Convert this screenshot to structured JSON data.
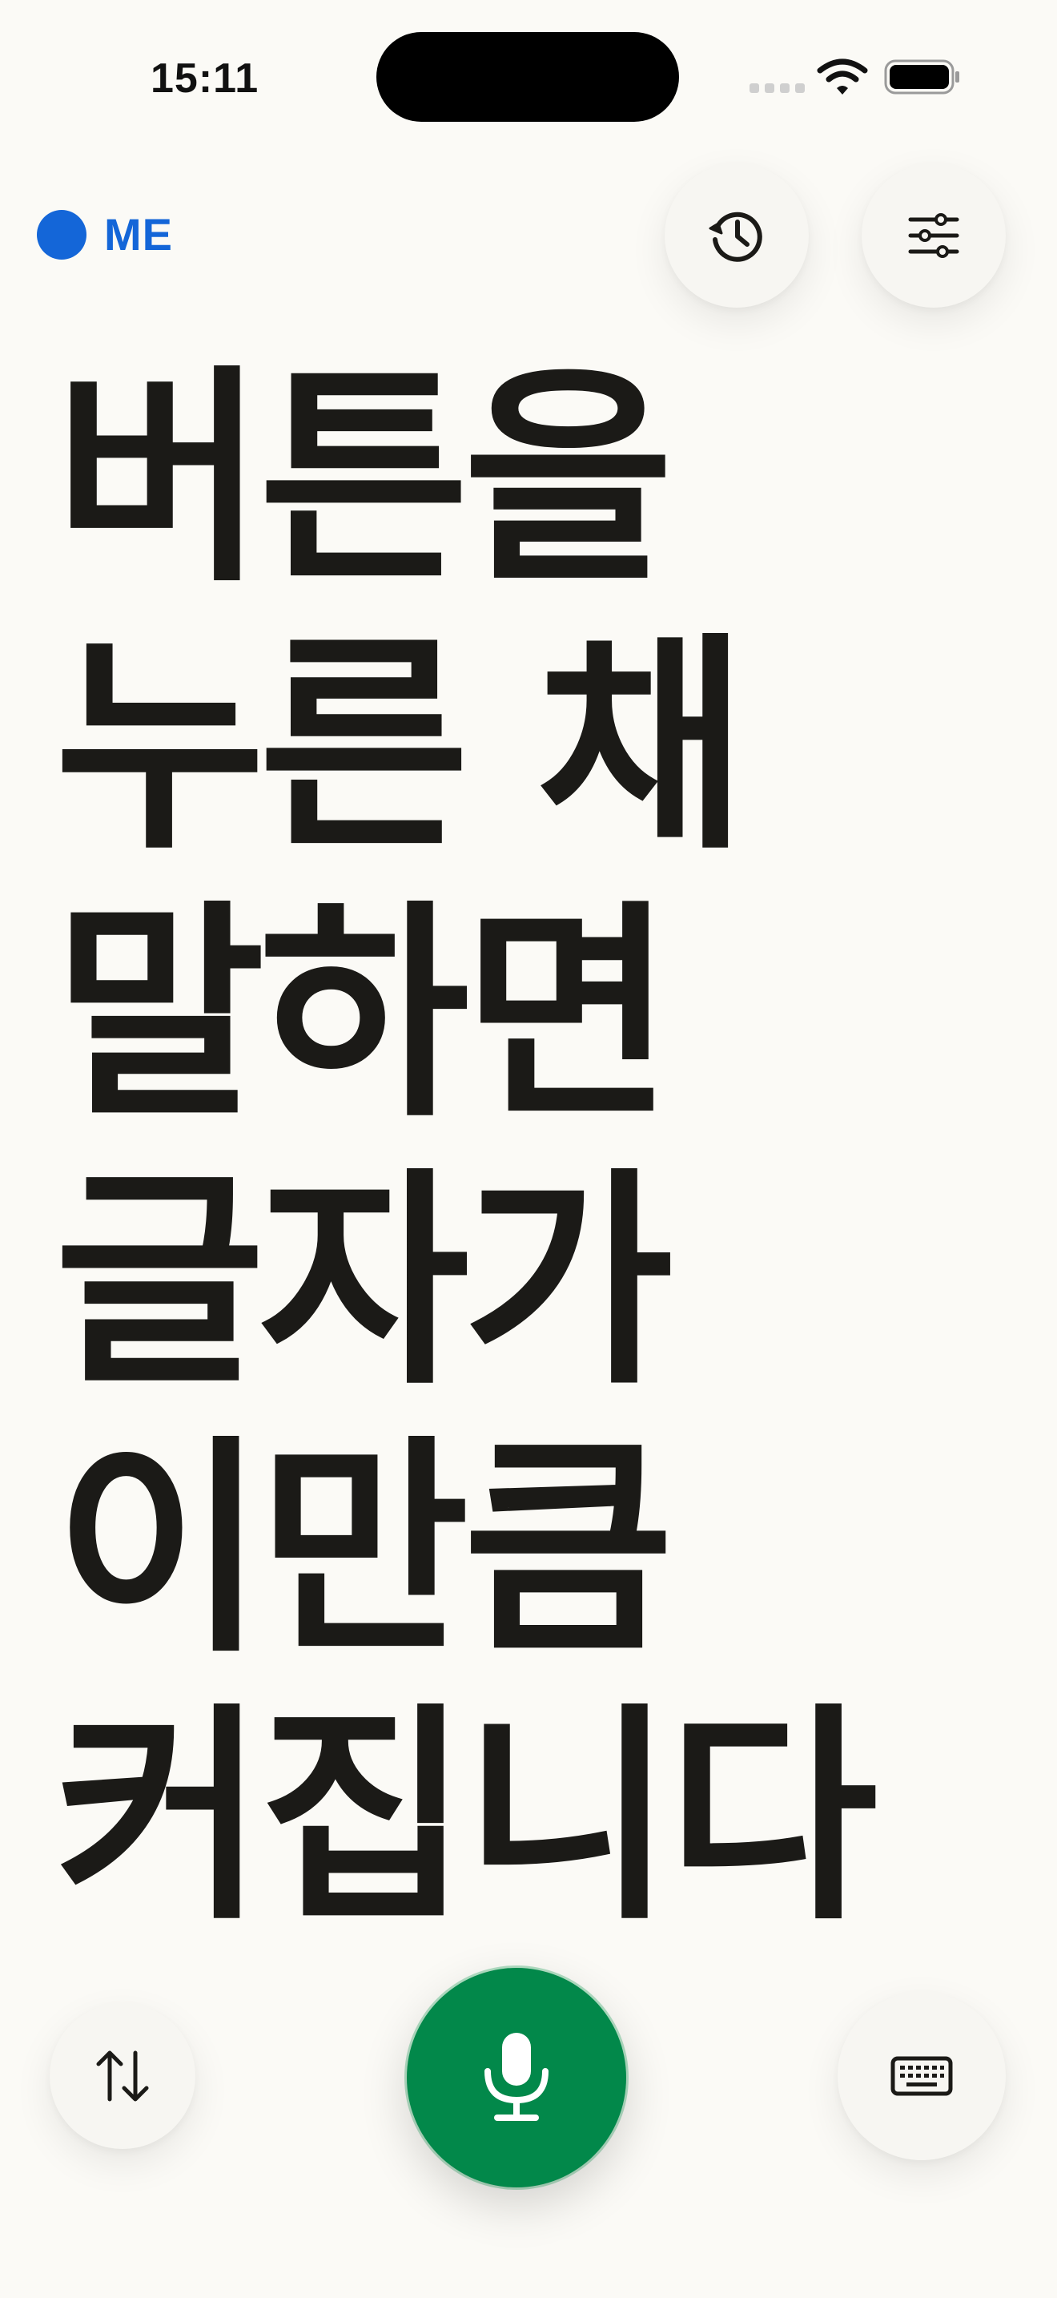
{
  "status_bar": {
    "time": "15:11"
  },
  "speaker": {
    "label": "ME",
    "color": "#1466d8"
  },
  "toolbar_top": {
    "history_icon": "history-clock-icon",
    "settings_icon": "sliders-icon"
  },
  "transcript": {
    "lines": [
      "버튼을",
      "누른 채",
      "말하면",
      "글자가",
      "이만큼",
      "커집니다"
    ]
  },
  "toolbar_bottom": {
    "swap_icon": "swap-arrows-icon",
    "mic_icon": "microphone-icon",
    "mic_color": "#02884a",
    "keyboard_icon": "keyboard-icon"
  }
}
